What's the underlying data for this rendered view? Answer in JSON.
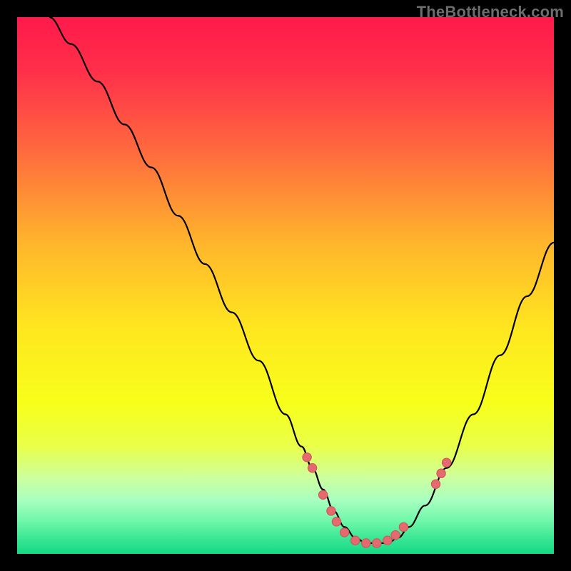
{
  "watermark": "TheBottleneck.com",
  "colors": {
    "gradient_stops": [
      {
        "offset": 0.0,
        "color": "#ff1a4b"
      },
      {
        "offset": 0.1,
        "color": "#ff2f4a"
      },
      {
        "offset": 0.25,
        "color": "#ff6a3e"
      },
      {
        "offset": 0.42,
        "color": "#ffb52c"
      },
      {
        "offset": 0.58,
        "color": "#ffe61f"
      },
      {
        "offset": 0.72,
        "color": "#f7ff1a"
      },
      {
        "offset": 0.8,
        "color": "#e9ff4a"
      },
      {
        "offset": 0.86,
        "color": "#ccffa0"
      },
      {
        "offset": 0.9,
        "color": "#a8ffc0"
      },
      {
        "offset": 0.94,
        "color": "#6cf7a8"
      },
      {
        "offset": 0.97,
        "color": "#3be795"
      },
      {
        "offset": 1.0,
        "color": "#16d884"
      }
    ],
    "curve": "#000000",
    "dot_fill": "#e46a6f",
    "dot_stroke": "#d14f55"
  },
  "chart_data": {
    "type": "line",
    "title": "",
    "xlabel": "",
    "ylabel": "",
    "xlim": [
      0,
      100
    ],
    "ylim": [
      0,
      100
    ],
    "series": [
      {
        "name": "bottleneck-curve",
        "x": [
          6,
          10,
          15,
          20,
          25,
          30,
          35,
          40,
          45,
          50,
          53,
          55,
          57,
          59,
          61,
          63,
          65,
          67,
          69,
          71,
          73,
          76,
          80,
          85,
          90,
          95,
          100
        ],
        "y": [
          100,
          95,
          88,
          80,
          72,
          63,
          54,
          45,
          36,
          26,
          20,
          16,
          12,
          8,
          5,
          3,
          2,
          2,
          2,
          3,
          5,
          9,
          16,
          26,
          37,
          48,
          58
        ]
      }
    ],
    "dots": {
      "name": "highlight-dots",
      "x": [
        54,
        55,
        57,
        58.5,
        59.5,
        61,
        63,
        65,
        67,
        69,
        70.5,
        72,
        78,
        79,
        80
      ],
      "y": [
        18,
        16,
        11,
        8,
        6,
        4,
        2.5,
        2,
        2,
        2.5,
        3.5,
        5,
        13,
        15,
        17
      ]
    }
  }
}
